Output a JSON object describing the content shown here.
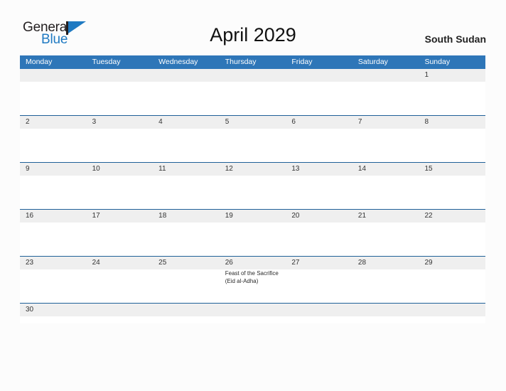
{
  "brand": {
    "name_top": "General",
    "name_bottom": "Blue",
    "flag_icon": "flag-triangle-icon",
    "accent_color": "#1f7ac2"
  },
  "header": {
    "title": "April 2029",
    "country": "South Sudan"
  },
  "colors": {
    "header_blue": "#2e76b8",
    "row_divider_blue": "#1f6098",
    "day_strip_gray": "#efefef",
    "page_background": "#fcfcfc"
  },
  "calendar": {
    "weekday_headers": [
      "Monday",
      "Tuesday",
      "Wednesday",
      "Thursday",
      "Friday",
      "Saturday",
      "Sunday"
    ],
    "weeks": [
      {
        "days": [
          {
            "number": "",
            "event": ""
          },
          {
            "number": "",
            "event": ""
          },
          {
            "number": "",
            "event": ""
          },
          {
            "number": "",
            "event": ""
          },
          {
            "number": "",
            "event": ""
          },
          {
            "number": "",
            "event": ""
          },
          {
            "number": "1",
            "event": ""
          }
        ]
      },
      {
        "days": [
          {
            "number": "2",
            "event": ""
          },
          {
            "number": "3",
            "event": ""
          },
          {
            "number": "4",
            "event": ""
          },
          {
            "number": "5",
            "event": ""
          },
          {
            "number": "6",
            "event": ""
          },
          {
            "number": "7",
            "event": ""
          },
          {
            "number": "8",
            "event": ""
          }
        ]
      },
      {
        "days": [
          {
            "number": "9",
            "event": ""
          },
          {
            "number": "10",
            "event": ""
          },
          {
            "number": "11",
            "event": ""
          },
          {
            "number": "12",
            "event": ""
          },
          {
            "number": "13",
            "event": ""
          },
          {
            "number": "14",
            "event": ""
          },
          {
            "number": "15",
            "event": ""
          }
        ]
      },
      {
        "days": [
          {
            "number": "16",
            "event": ""
          },
          {
            "number": "17",
            "event": ""
          },
          {
            "number": "18",
            "event": ""
          },
          {
            "number": "19",
            "event": ""
          },
          {
            "number": "20",
            "event": ""
          },
          {
            "number": "21",
            "event": ""
          },
          {
            "number": "22",
            "event": ""
          }
        ]
      },
      {
        "days": [
          {
            "number": "23",
            "event": ""
          },
          {
            "number": "24",
            "event": ""
          },
          {
            "number": "25",
            "event": ""
          },
          {
            "number": "26",
            "event": "Feast of the Sacrifice (Eid al-Adha)"
          },
          {
            "number": "27",
            "event": ""
          },
          {
            "number": "28",
            "event": ""
          },
          {
            "number": "29",
            "event": ""
          }
        ]
      },
      {
        "days": [
          {
            "number": "30",
            "event": ""
          },
          {
            "number": "",
            "event": ""
          },
          {
            "number": "",
            "event": ""
          },
          {
            "number": "",
            "event": ""
          },
          {
            "number": "",
            "event": ""
          },
          {
            "number": "",
            "event": ""
          },
          {
            "number": "",
            "event": ""
          }
        ]
      }
    ]
  }
}
